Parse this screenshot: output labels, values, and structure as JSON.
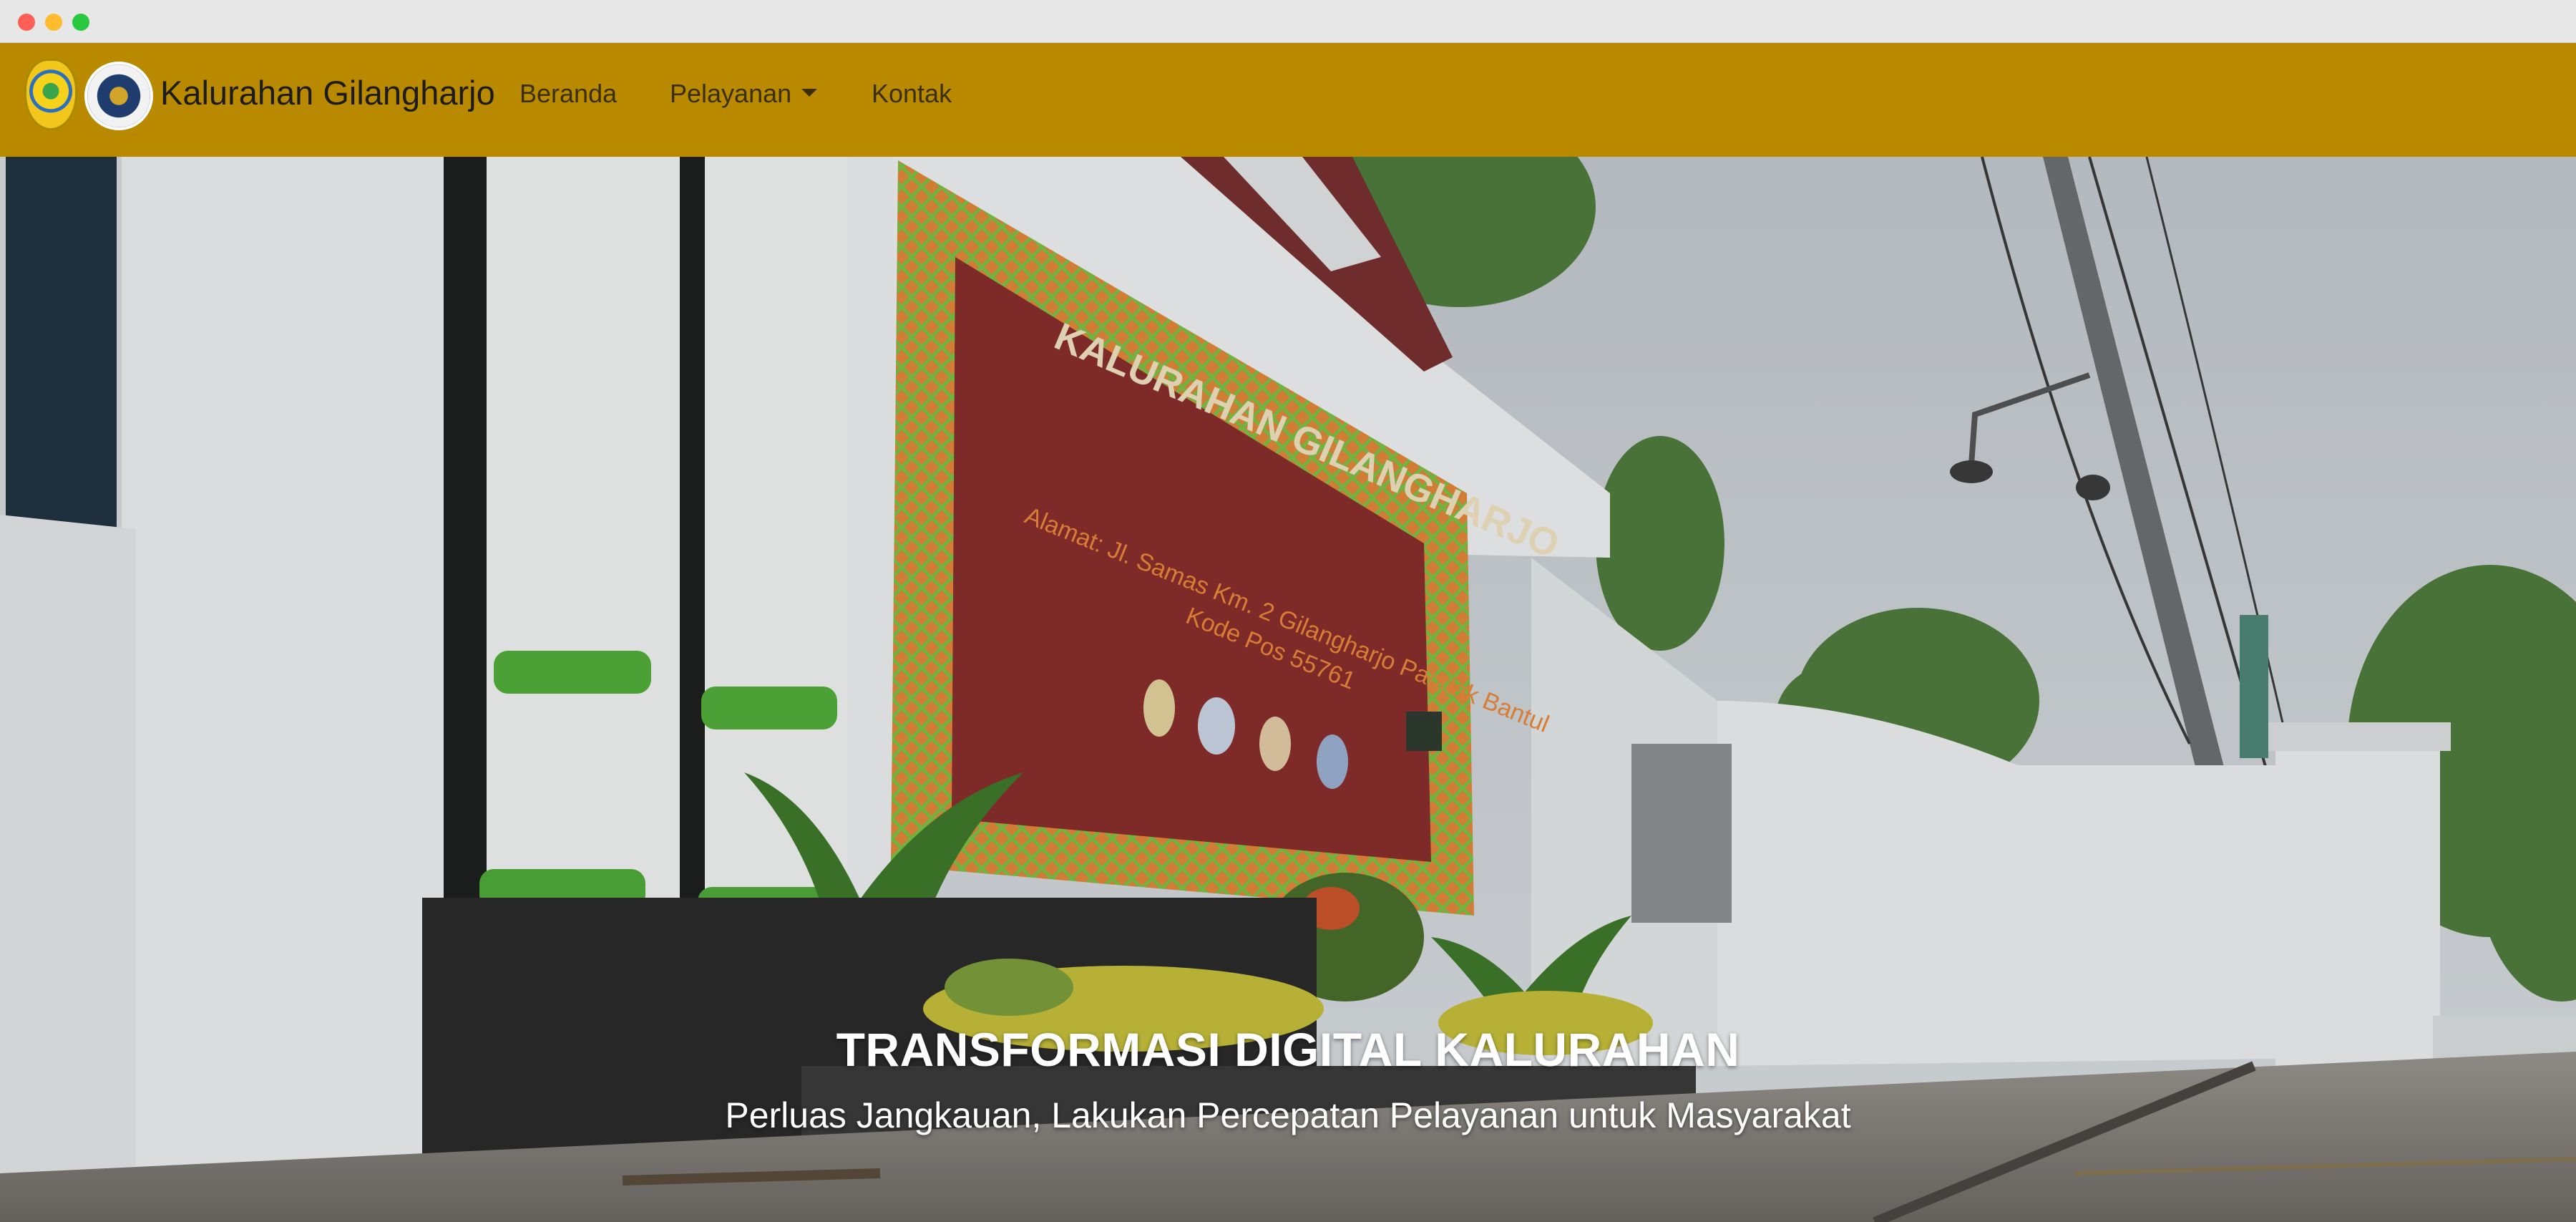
{
  "theme": {
    "navbar_bg": "#b98a00",
    "navbar_text": "#3a2f00",
    "hero_text": "#ffffff"
  },
  "navbar": {
    "brand": "Kalurahan Gilangharjo",
    "logos": [
      "bantul-regency-logo",
      "kalurahan-seal-logo"
    ],
    "links": [
      {
        "label": "Beranda"
      },
      {
        "label": "Pelayanan",
        "has_dropdown": true
      },
      {
        "label": "Kontak"
      }
    ]
  },
  "hero": {
    "image": "kalurahan-office-gate-photo",
    "sign_title": "KALURAHAN GILANGHARJO",
    "sign_address": "Alamat: Jl. Samas Km. 2 Gilangharjo Pandak Bantul",
    "sign_postal": "Kode Pos 55761",
    "title": "TRANSFORMASI DIGITAL KALURAHAN",
    "subtitle": "Perluas Jangkauan, Lakukan Percepatan Pelayanan untuk Masyarakat"
  }
}
